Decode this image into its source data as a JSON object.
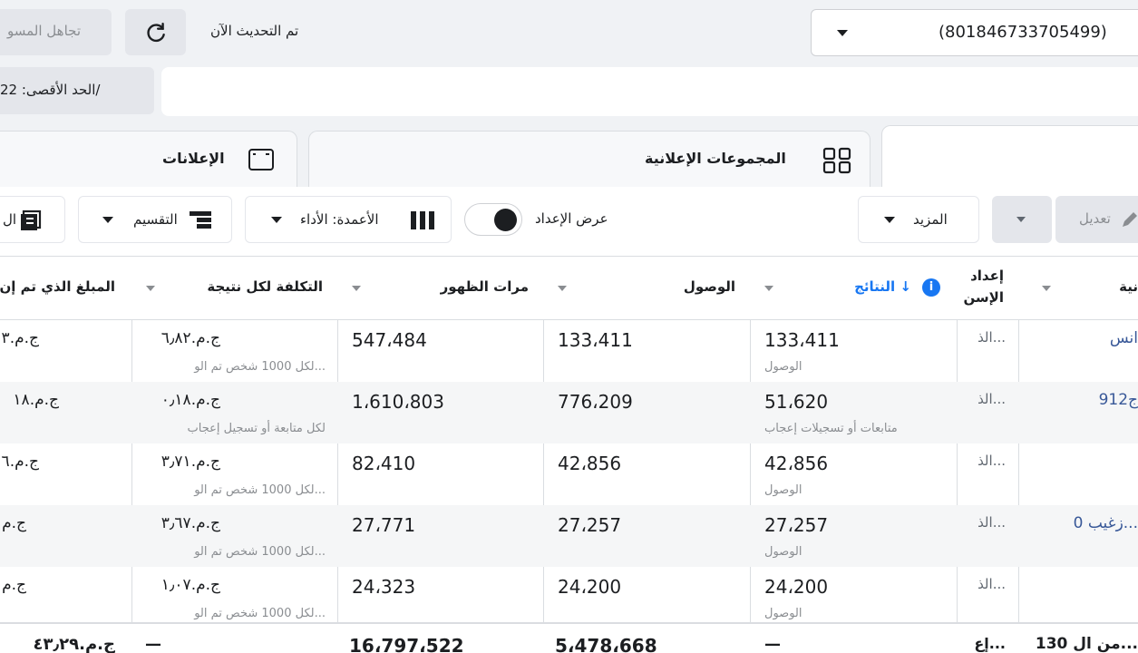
{
  "top": {
    "account_value": "(801846733705499)",
    "updated_text": "تم التحديث الآن",
    "ignore_label": "تجاهل المسو",
    "max_label": "الحد الأقصى: 22/"
  },
  "tabs": {
    "adsets": "المجموعات الإعلانية",
    "ads": "الإعلانات"
  },
  "toolbar": {
    "edit": "تعديل",
    "more": "المزيد",
    "show_setup": "عرض الإعداد",
    "columns": "الأعمدة: الأداء",
    "breakdown": "التقسيم",
    "reports": "ال"
  },
  "table": {
    "headers": {
      "name": "نية",
      "setup_line1": "إعداد",
      "setup_line2": "الإسن",
      "results": "النتائج ↓",
      "reach": "الوصول",
      "impressions": "مرات الظهور",
      "cpr": "التكلفة لكل نتيجة",
      "spent": "المبلغ الذي تم إن"
    },
    "rows": [
      {
        "name": "انس",
        "setup": "الذ...",
        "results": "133،411",
        "results_sub": "الوصول",
        "reach": "133،411",
        "impressions": "547،484",
        "cpr": "ج.م.٦٫٨٢",
        "cpr_sub": "لكل 1000 شخص تم الو...",
        "spent": "ج.م.٣"
      },
      {
        "name": "912ج",
        "setup": "الذ...",
        "results": "51،620",
        "results_sub": "متابعات أو تسجيلات إعجاب",
        "reach": "776،209",
        "impressions": "1،610،803",
        "cpr": "ج.م.٠٫١٨",
        "cpr_sub": "لكل متابعة أو تسجيل إعجاب",
        "spent": "ج.م.١٨"
      },
      {
        "name": "",
        "setup": "الذ...",
        "results": "42،856",
        "results_sub": "الوصول",
        "reach": "42،856",
        "impressions": "82،410",
        "cpr": "ج.م.٣٫٧١",
        "cpr_sub": "لكل 1000 شخص تم الو...",
        "spent": "ج.م.٦"
      },
      {
        "name": "زغيب 0...",
        "setup": "الذ...",
        "results": "27،257",
        "results_sub": "الوصول",
        "reach": "27،257",
        "impressions": "27،771",
        "cpr": "ج.م.٣٫٦٧",
        "cpr_sub": "لكل 1000 شخص تم الو...",
        "spent": "ج.م"
      },
      {
        "name": "",
        "setup": "الذ...",
        "results": "24،200",
        "results_sub": "الوصول",
        "reach": "24،200",
        "impressions": "24،323",
        "cpr": "ج.م.١٫٠٧",
        "cpr_sub": "لكل 1000 شخص تم الو...",
        "spent": "ج.م"
      }
    ],
    "total": {
      "name": "130 من ال...",
      "setup": "إع...",
      "results": "—",
      "reach": "5،478،668",
      "impressions": "16،797،522",
      "cpr": "—",
      "spent": "ج.م.٤٣٫٢٩"
    }
  }
}
